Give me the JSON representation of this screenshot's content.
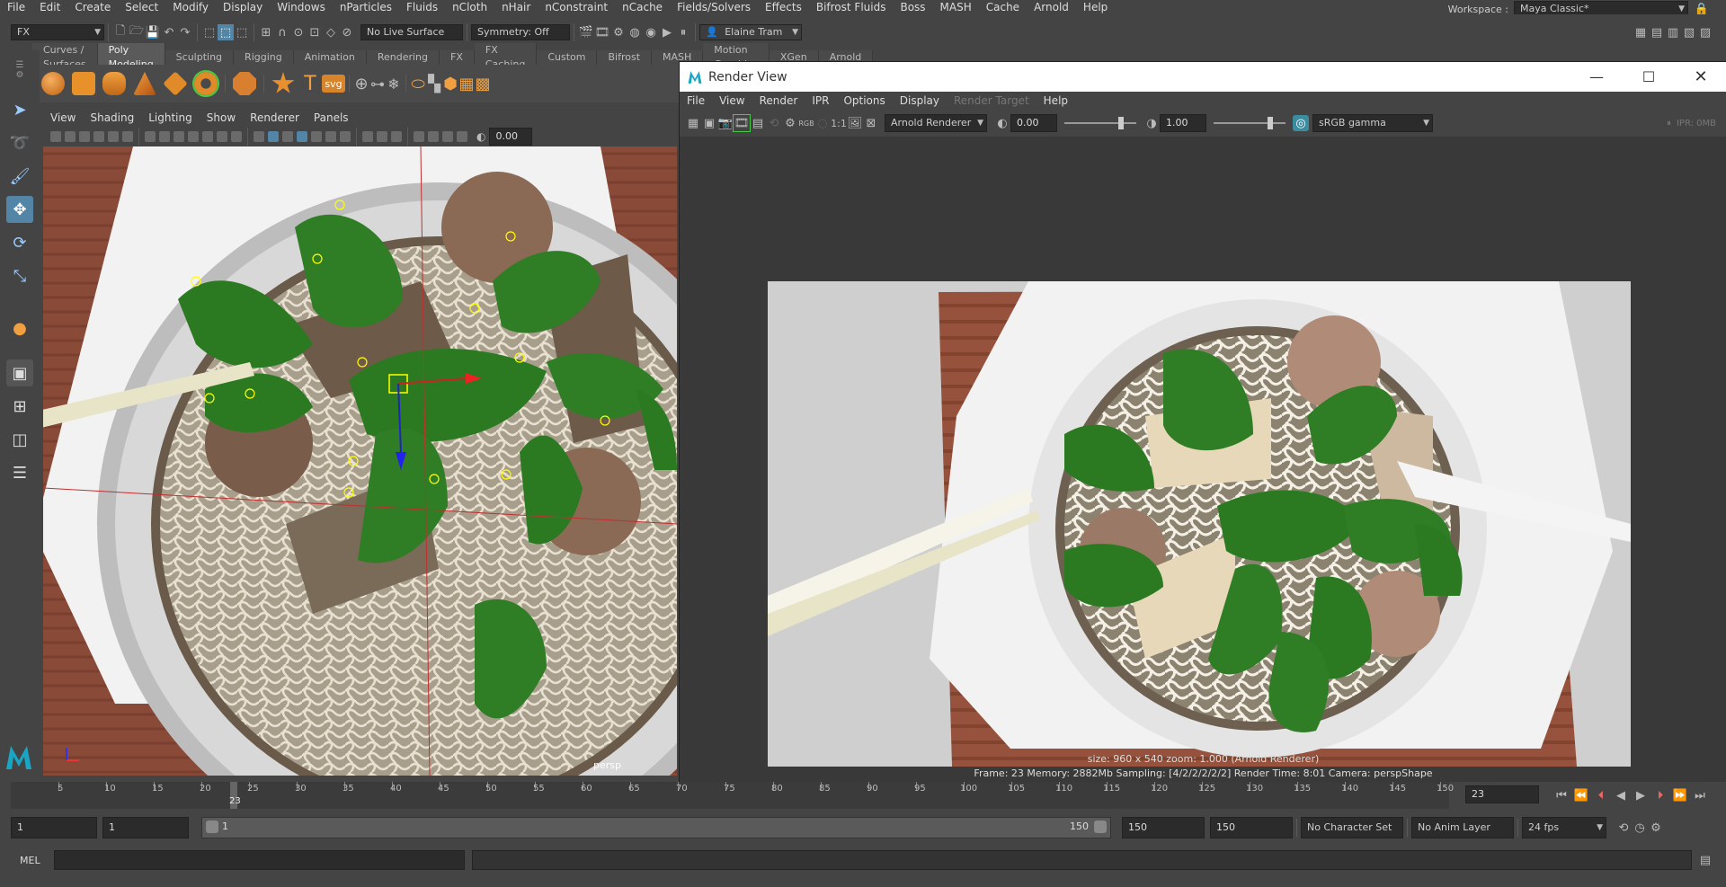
{
  "menubar": {
    "items": [
      "File",
      "Edit",
      "Create",
      "Select",
      "Modify",
      "Display",
      "Windows",
      "nParticles",
      "Fluids",
      "nCloth",
      "nHair",
      "nConstraint",
      "nCache",
      "Fields/Solvers",
      "Effects",
      "Bifrost Fluids",
      "Boss",
      "MASH",
      "Cache",
      "Arnold",
      "Help"
    ],
    "workspace_label": "Workspace :",
    "workspace_value": "Maya Classic*"
  },
  "statusline": {
    "menuset": "FX",
    "live_surface": "No Live Surface",
    "symmetry": "Symmetry: Off",
    "user": "Elaine Tram"
  },
  "shelf": {
    "tabs": [
      "Curves / Surfaces",
      "Poly Modeling",
      "Sculpting",
      "Rigging",
      "Animation",
      "Rendering",
      "FX",
      "FX Caching",
      "Custom",
      "Bifrost",
      "MASH",
      "Motion Graphics",
      "XGen",
      "Arnold"
    ],
    "active_tab": "Poly Modeling",
    "text_icon": "T",
    "svg_icon": "svg"
  },
  "viewport": {
    "menu": [
      "View",
      "Shading",
      "Lighting",
      "Show",
      "Renderer",
      "Panels"
    ],
    "exposure": "0.00",
    "camera_label": "persp"
  },
  "renderview": {
    "title": "Render View",
    "menu": [
      "File",
      "View",
      "Render",
      "IPR",
      "Options",
      "Display",
      "Render Target",
      "Help"
    ],
    "disabled_menu": "Render Target",
    "renderer": "Arnold Renderer",
    "exposure": "0.00",
    "gamma": "1.00",
    "colorspace": "sRGB gamma",
    "ratio": "1:1",
    "ipr_mem": "IPR: 0MB",
    "info_line1": "size: 960 x 540  zoom: 1.000     (Arnold Renderer)",
    "info_line2": "Frame: 23    Memory: 2882Mb    Sampling: [4/2/2/2/2/2]    Render Time: 8:01    Camera: perspShape"
  },
  "timeslider": {
    "ticks": [
      "5",
      "10",
      "15",
      "20",
      "25",
      "30",
      "35",
      "40",
      "45",
      "50",
      "55",
      "60",
      "65",
      "70",
      "75",
      "80",
      "85",
      "90",
      "95",
      "100",
      "105",
      "110",
      "115",
      "120",
      "125",
      "130",
      "135",
      "140",
      "145",
      "150"
    ],
    "current_frame_marker": "23",
    "current_frame": "23"
  },
  "range": {
    "start": "1",
    "start_inner": "1",
    "slider_start": "1",
    "slider_end": "150",
    "end_inner": "150",
    "end": "150",
    "character_set": "No Character Set",
    "anim_layer": "No Anim Layer",
    "fps": "24 fps"
  },
  "cmdline": {
    "label": "MEL"
  },
  "colors": {
    "accent": "#5285a6",
    "leaf": "#2f7d25",
    "table": "#8a4a38",
    "bowl": "#d8d8d8"
  }
}
